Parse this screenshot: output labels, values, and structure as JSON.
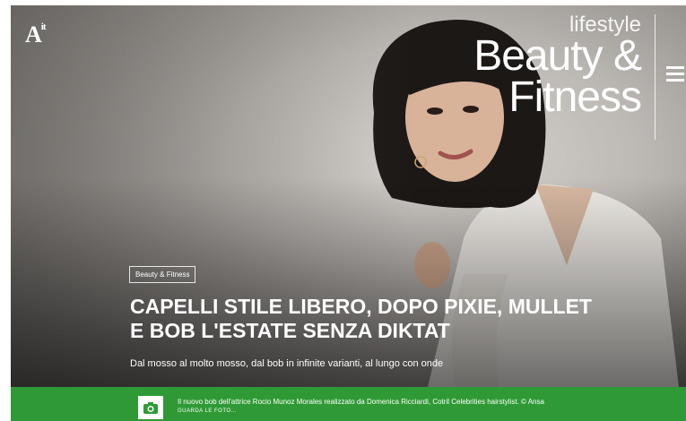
{
  "logo": {
    "text": "A",
    "suffix": "it"
  },
  "section": {
    "small": "lifestyle",
    "line1": "Beauty &",
    "line2": "Fitness"
  },
  "article": {
    "category": "Beauty & Fitness",
    "headline": "CAPELLI STILE LIBERO, DOPO PIXIE, MULLET E BOB L'ESTATE SENZA DIKTAT",
    "subtitle": "Dal mosso al molto mosso, dal bob in infinite varianti, al lungo con onde"
  },
  "caption": {
    "text": "Il nuovo bob dell'attrice Rocio Munoz Morales realizzato da Domenica Ricciardi, Cotril Celebrities hairstylist. © Ansa",
    "link": "GUARDA LE FOTO..."
  },
  "icons": {
    "menu": "hamburger-icon",
    "photo": "camera-icon"
  },
  "colors": {
    "caption_bar": "#2f9a35",
    "text": "#ffffff"
  }
}
